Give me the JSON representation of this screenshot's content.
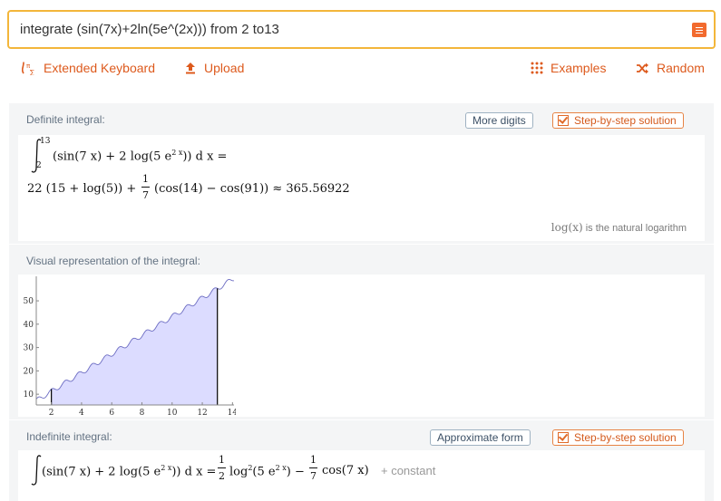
{
  "search": {
    "value": "integrate (sin(7x)+2ln(5e^(2x))) from 2 to13"
  },
  "toolbar": {
    "extended_keyboard": "Extended Keyboard",
    "upload": "Upload",
    "examples": "Examples",
    "random": "Random"
  },
  "definite": {
    "title": "Definite integral:",
    "more_digits": "More digits",
    "step_by_step": "Step-by-step solution",
    "lower": "2",
    "upper": "13",
    "integrand": "(sin(7 x) + 2 log(5 e",
    "exp": "2 x",
    "integrand_end": ")) d x =",
    "result_a": "22 (15 + log(5)) +",
    "frac_num": "1",
    "frac_den": "7",
    "result_b": "(cos(14) − cos(91)) ≈ 365.56922",
    "note_fn": "log(x)",
    "note_text": "is the natural logarithm"
  },
  "visual": {
    "title": "Visual representation of the integral:"
  },
  "chart_data": {
    "type": "area",
    "title": "",
    "xlabel": "",
    "ylabel": "",
    "function": "sin(7x)+2ln(5e^(2x))",
    "shaded_interval": [
      2,
      13
    ],
    "xlim": [
      1.0,
      14.1
    ],
    "ylim": [
      5.4,
      60.5
    ],
    "x_ticks": [
      2,
      4,
      6,
      8,
      10,
      12,
      14
    ],
    "y_ticks": [
      10,
      20,
      30,
      40,
      50
    ],
    "colors": {
      "curve": "#6b6bc2",
      "fill": "#dcdcff",
      "bounds": "#000000"
    }
  },
  "indefinite": {
    "title": "Indefinite integral:",
    "approx": "Approximate form",
    "step_by_step": "Step-by-step solution",
    "lhs_a": "(sin(7 x) + 2 log(5 e",
    "lhs_exp": "2 x",
    "lhs_b": ")) d x =",
    "f1_num": "1",
    "f1_den": "2",
    "log2": "log",
    "log2_sup": "2",
    "log2_arg": "(5 e",
    "log2_exp": "2 x",
    "log2_end": ") −",
    "f2_num": "1",
    "f2_den": "7",
    "cos": "cos(7 x)",
    "constant": "+ constant"
  }
}
